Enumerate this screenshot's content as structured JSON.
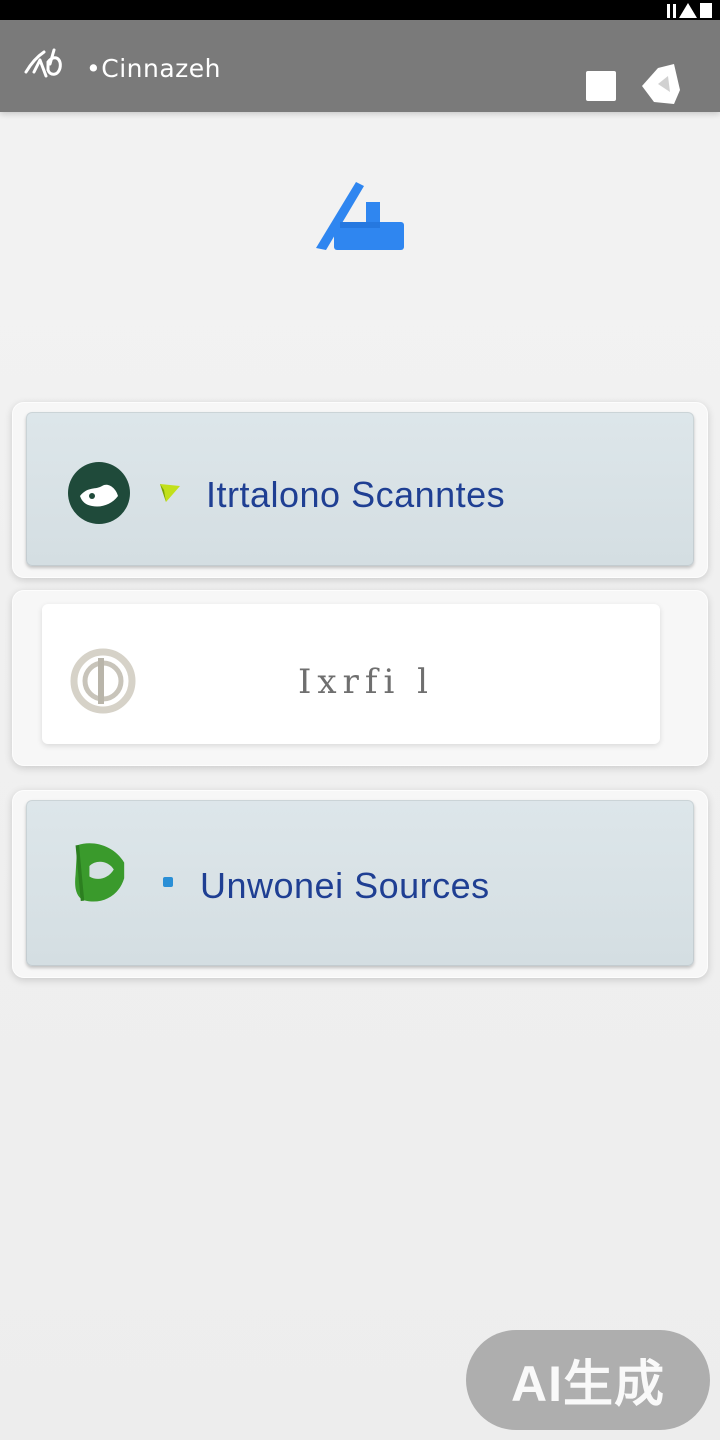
{
  "app_bar": {
    "title": "•Cinnazeh",
    "logo_icon": "leaf-logo-icon",
    "actions": [
      {
        "icon": "stop-square-icon"
      },
      {
        "icon": "tag-icon"
      }
    ]
  },
  "hero": {
    "icon": "brand-a-logo-icon",
    "color": "#2f86f0"
  },
  "menu": {
    "items": [
      {
        "label": "Itrtalono Scanntes",
        "icon": "leaf-circle-icon",
        "bullet": "triangle-bullet-icon"
      },
      {
        "label": "Ixrfi l",
        "icon": "gray-ring-icon",
        "bullet": ""
      },
      {
        "label": "Unwonei Sources",
        "icon": "green-leaf-icon",
        "bullet": "dot-bullet-icon"
      }
    ]
  },
  "watermark": {
    "text": "AI生成"
  },
  "colors": {
    "app_bar": "#7a7a7a",
    "card_blue": "#d6e0e4",
    "label_blue": "#1f3f93",
    "accent_green": "#3a9a2c",
    "accent_blue": "#2f86f0"
  }
}
